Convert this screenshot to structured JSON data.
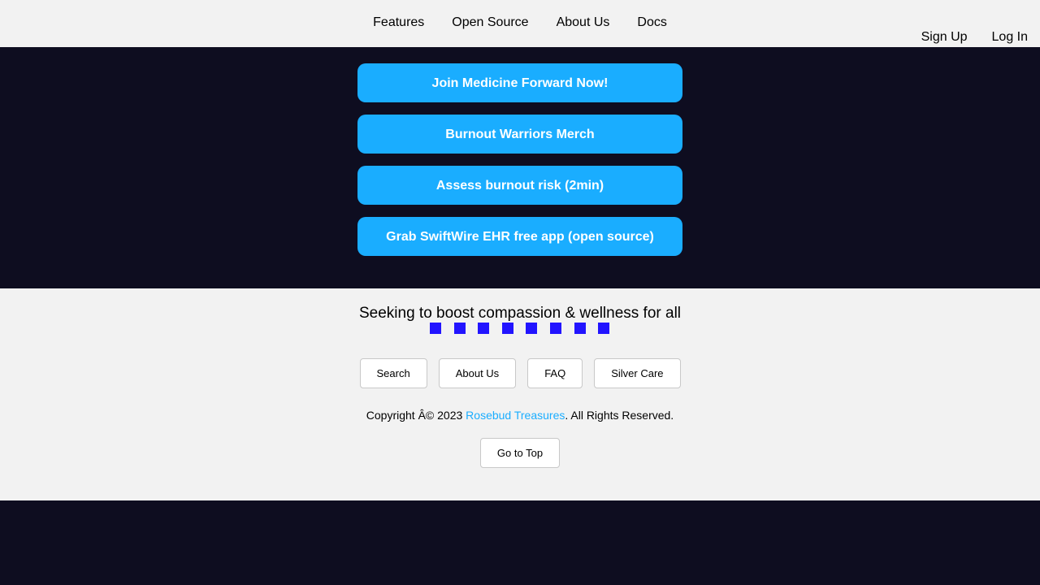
{
  "nav": {
    "items": [
      "Features",
      "Open Source",
      "About Us",
      "Docs"
    ],
    "sign_up": "Sign Up",
    "log_in": "Log In"
  },
  "hero": {
    "buttons": [
      "Join Medicine Forward Now!",
      "Burnout Warriors Merch",
      "Assess burnout risk (2min)",
      "Grab SwiftWire EHR free app (open source)"
    ]
  },
  "footer": {
    "tagline": "Seeking to boost compassion & wellness for all",
    "links": [
      "Search",
      "About Us",
      "FAQ",
      "Silver Care"
    ],
    "copyright_prefix": "Copyright Â© 2023 ",
    "copyright_brand": "Rosebud Treasures",
    "copyright_suffix": ". All Rights Reserved.",
    "go_top": "Go to Top"
  },
  "colors": {
    "accent": "#1aadff",
    "dark_bg": "#0e0d20",
    "light_bg": "#f2f2f2",
    "dot": "#2214ff"
  }
}
